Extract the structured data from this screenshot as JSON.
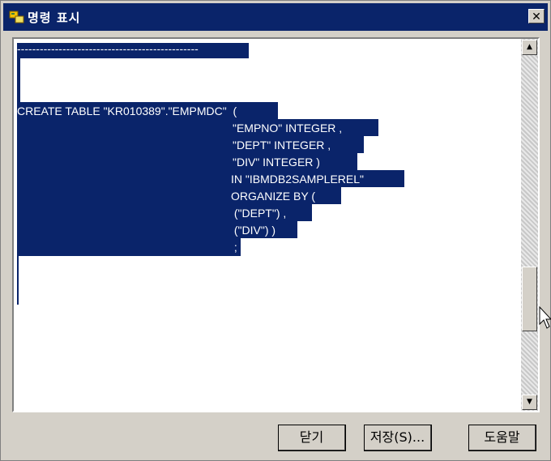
{
  "window": {
    "title": "명령 표시",
    "close_label": "✕"
  },
  "content": {
    "lines": [
      "------------------------------------------------",
      "",
      "",
      "",
      "CREATE TABLE \"KR010389\".\"EMPMDC\"  (",
      "\"EMPNO\" INTEGER ,",
      "\"DEPT\" INTEGER ,",
      "\"DIV\" INTEGER )",
      "IN \"IBMDB2SAMPLEREL\"",
      "ORGANIZE BY (",
      " (\"DEPT\") ,",
      " (\"DIV\") )",
      " ;"
    ]
  },
  "scrollbar": {
    "up_icon": "▲",
    "down_icon": "▼"
  },
  "buttons": {
    "close": "닫기",
    "save": "저장(S)...",
    "help": "도움말"
  }
}
